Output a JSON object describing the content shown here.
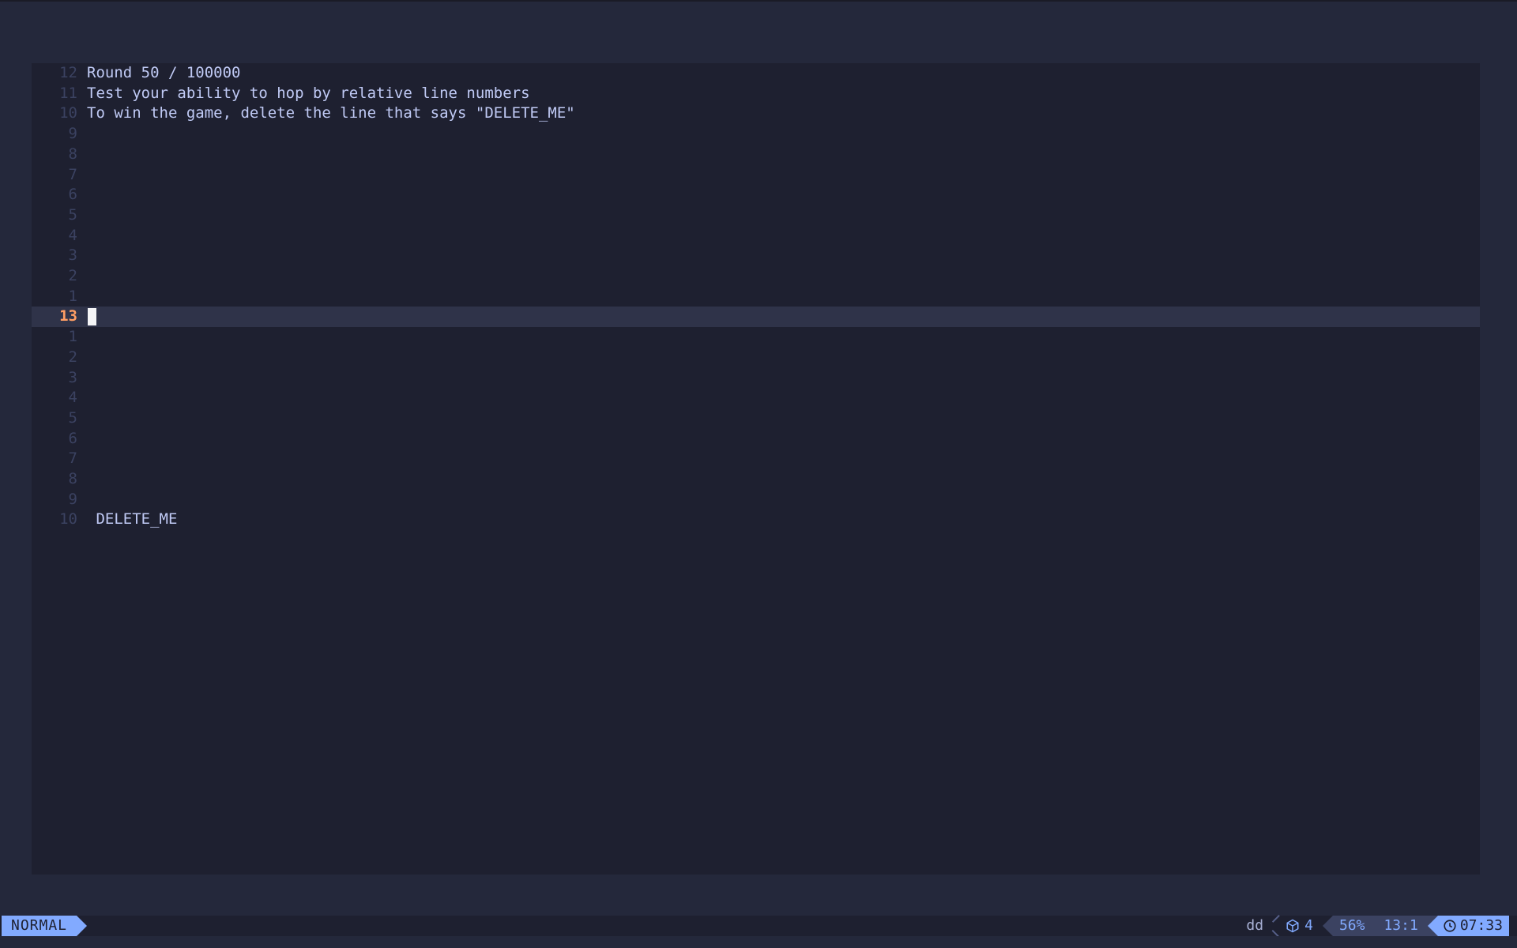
{
  "editor": {
    "lines": [
      {
        "num": "12",
        "text": "Round 50 / 100000"
      },
      {
        "num": "11",
        "text": "Test your ability to hop by relative line numbers"
      },
      {
        "num": "10",
        "text": "To win the game, delete the line that says \"DELETE_ME\""
      },
      {
        "num": "9",
        "text": ""
      },
      {
        "num": "8",
        "text": ""
      },
      {
        "num": "7",
        "text": ""
      },
      {
        "num": "6",
        "text": ""
      },
      {
        "num": "5",
        "text": ""
      },
      {
        "num": "4",
        "text": ""
      },
      {
        "num": "3",
        "text": ""
      },
      {
        "num": "2",
        "text": ""
      },
      {
        "num": "1",
        "text": ""
      },
      {
        "num": "13",
        "text": "",
        "current": true
      },
      {
        "num": "1",
        "text": ""
      },
      {
        "num": "2",
        "text": ""
      },
      {
        "num": "3",
        "text": ""
      },
      {
        "num": "4",
        "text": ""
      },
      {
        "num": "5",
        "text": ""
      },
      {
        "num": "6",
        "text": ""
      },
      {
        "num": "7",
        "text": ""
      },
      {
        "num": "8",
        "text": ""
      },
      {
        "num": "9",
        "text": ""
      },
      {
        "num": "10",
        "text": " DELETE_ME"
      }
    ]
  },
  "statusline": {
    "mode": "NORMAL",
    "pending_command": "dd",
    "lsp_count": "4",
    "progress": "56%",
    "position": "13:1",
    "clock": "07:33",
    "colors": {
      "mode_bg": "#82aaff",
      "segment_bg": "#3b4261",
      "current_line_number": "#ff9e64"
    }
  }
}
